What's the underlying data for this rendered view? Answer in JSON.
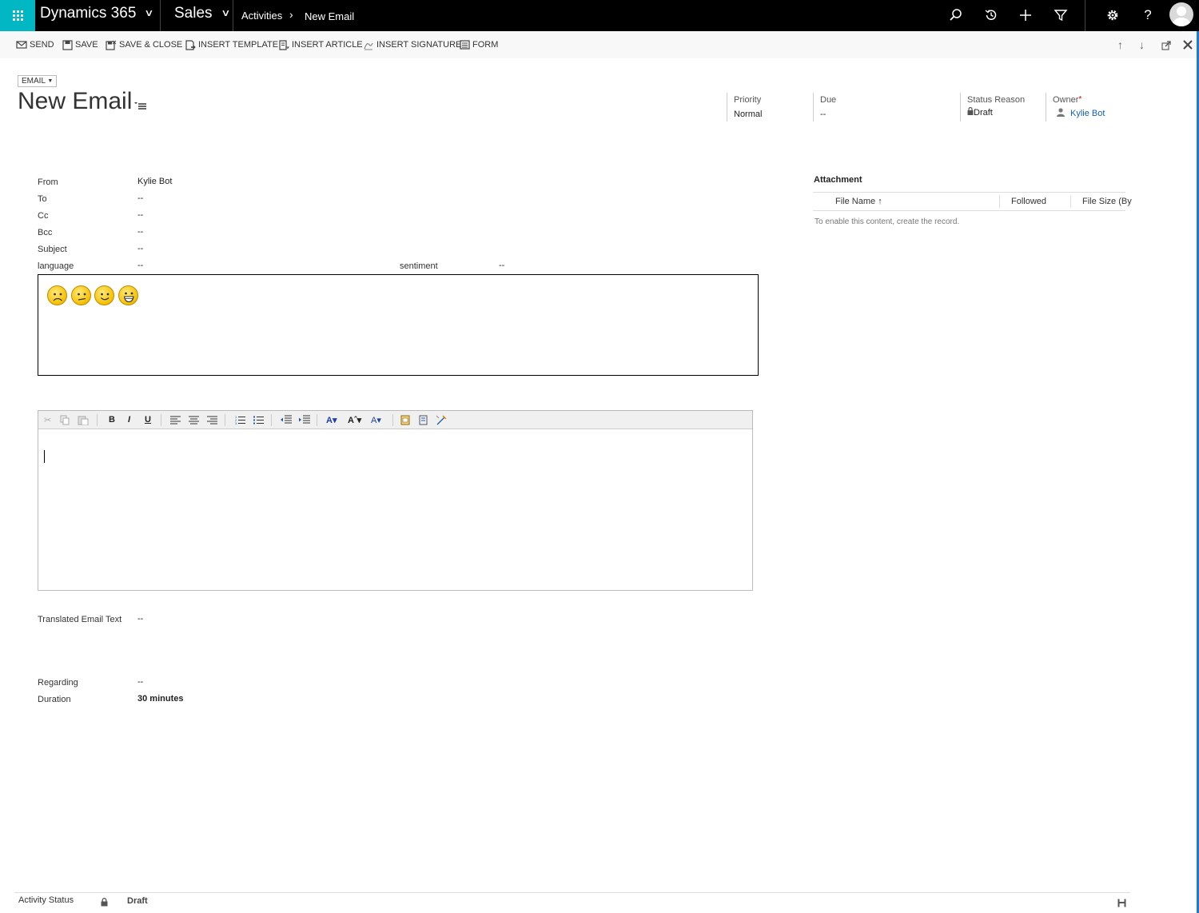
{
  "topnav": {
    "brand": "Dynamics 365",
    "app": "Sales",
    "breadcrumb": [
      "Activities",
      "New Email"
    ],
    "colors": {
      "bar": "#000000",
      "waffle": "#00b7c3"
    }
  },
  "commands": {
    "send": "SEND",
    "save": "SAVE",
    "save_close": "SAVE & CLOSE",
    "insert_template": "INSERT TEMPLATE",
    "insert_article": "INSERT ARTICLE",
    "insert_signature": "INSERT SIGNATURE",
    "form": "FORM"
  },
  "header": {
    "entity_type": "EMAIL",
    "title": "New Email",
    "priority": {
      "label": "Priority",
      "value": "Normal"
    },
    "due": {
      "label": "Due",
      "value": "--"
    },
    "status_reason": {
      "label": "Status Reason",
      "value": "Draft"
    },
    "owner": {
      "label": "Owner",
      "required": "*",
      "value": "Kylie Bot"
    }
  },
  "form": {
    "from": {
      "label": "From",
      "value": "Kylie Bot"
    },
    "to": {
      "label": "To",
      "value": "--"
    },
    "cc": {
      "label": "Cc",
      "value": "--"
    },
    "bcc": {
      "label": "Bcc",
      "value": "--"
    },
    "subject": {
      "label": "Subject",
      "value": "--"
    },
    "language": {
      "label": "language",
      "value": "--"
    },
    "sentiment": {
      "label": "sentiment",
      "value": "--"
    },
    "sentiment_faces": [
      "sad-face-icon",
      "confused-face-icon",
      "smile-face-icon",
      "grin-face-icon"
    ],
    "translated": {
      "label": "Translated Email Text",
      "value": "--"
    },
    "regarding": {
      "label": "Regarding",
      "value": "--"
    },
    "duration": {
      "label": "Duration",
      "value": "30 minutes"
    }
  },
  "editor": {
    "toolbar": {
      "bold": "B",
      "italic": "I",
      "underline": "U"
    }
  },
  "attachment": {
    "title": "Attachment",
    "columns": [
      "File Name",
      "Followed",
      "File Size (By"
    ],
    "sort_indicator": "↑",
    "empty_message": "To enable this content, create the record."
  },
  "footer": {
    "label": "Activity Status",
    "value": "Draft"
  }
}
